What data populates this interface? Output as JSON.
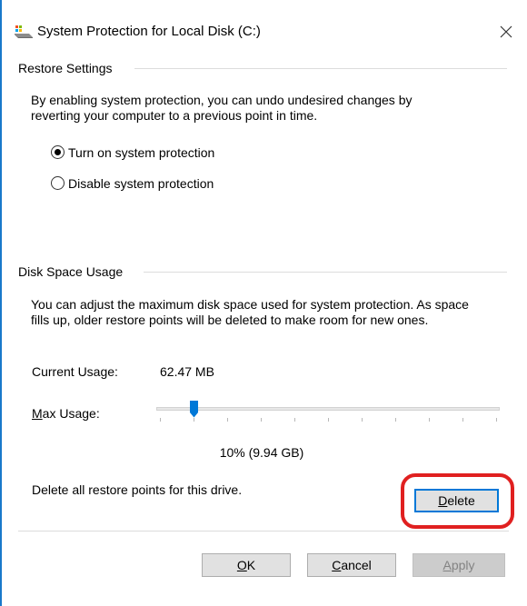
{
  "window": {
    "title": "System Protection for Local Disk (C:)",
    "accent_color": "#1979ca"
  },
  "restore_settings": {
    "header": "Restore Settings",
    "description_lines": [
      "By enabling system protection, you can undo undesired changes by",
      "reverting your computer to a previous point in time."
    ],
    "options": [
      {
        "label": "Turn on system protection",
        "selected": true
      },
      {
        "label": "Disable system protection",
        "selected": false
      }
    ]
  },
  "disk_space": {
    "header": "Disk Space Usage",
    "description_lines": [
      "You can adjust the maximum disk space used for system protection. As space",
      "fills up, older restore points will be deleted to make room for new ones."
    ],
    "current_usage_label": "Current Usage:",
    "current_usage_value": "62.47 MB",
    "max_usage_label_mnemonic": "M",
    "max_usage_label_rest": "ax Usage:",
    "max_usage_fraction": 0.1,
    "max_usage_text": "10% (9.94 GB)",
    "delete_description": "Delete all restore points for this drive.",
    "delete_label_mnemonic": "D",
    "delete_label_rest": "elete",
    "highlight_color": "#e02020"
  },
  "buttons": {
    "ok_mnemonic": "O",
    "ok_rest": "K",
    "cancel_mnemonic": "C",
    "cancel_rest": "ancel",
    "apply_mnemonic": "A",
    "apply_rest": "pply",
    "apply_disabled": true
  }
}
